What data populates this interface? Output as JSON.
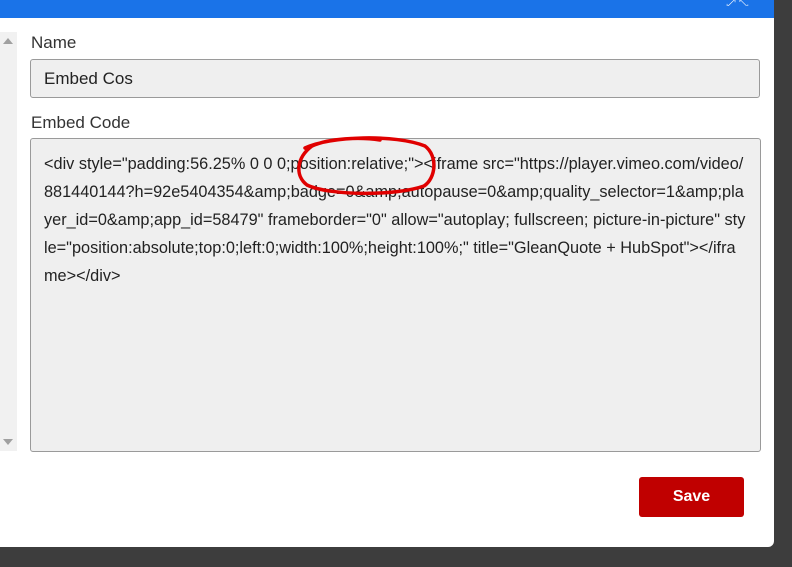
{
  "form": {
    "name_label": "Name",
    "name_value": "Embed Cos",
    "embed_label": "Embed Code",
    "embed_value": "<div style=\"padding:56.25% 0 0 0;position:relative;\"><iframe src=\"https://player.vimeo.com/video/881440144?h=92e5404354&amp;badge=0&amp;autopause=0&amp;quality_selector=1&amp;player_id=0&amp;app_id=58479\" frameborder=\"0\" allow=\"autoplay; fullscreen; picture-in-picture\" style=\"position:absolute;top:0;left:0;width:100%;height:100%;\" title=\"GleanQuote + HubSpot\"></iframe></div>"
  },
  "actions": {
    "save_label": "Save"
  },
  "colors": {
    "titlebar": "#1a73e8",
    "save_button": "#c00000",
    "annotation": "#e00000"
  }
}
